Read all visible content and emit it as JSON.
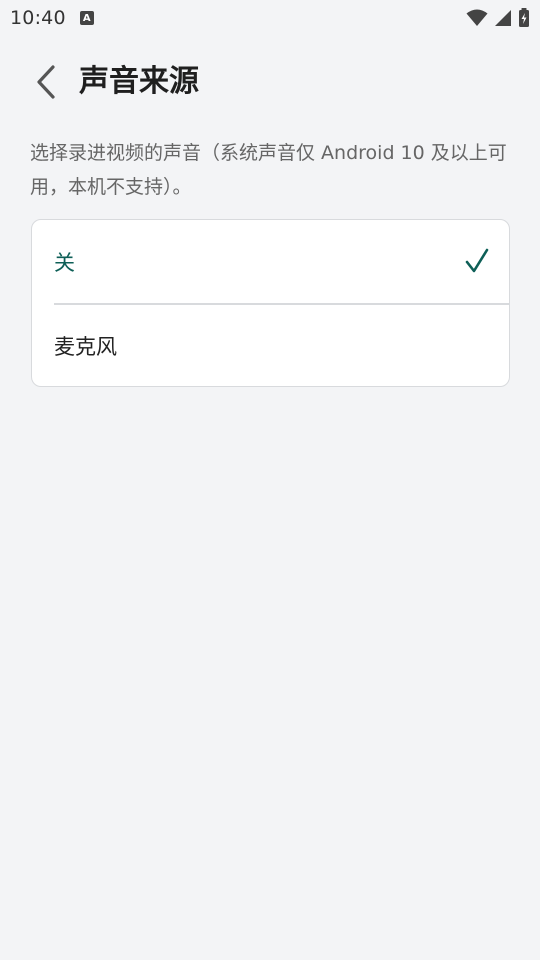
{
  "status_bar": {
    "time": "10:40",
    "notification_icon": "a-icon",
    "icons": [
      "wifi-icon",
      "cellular-signal-icon",
      "battery-charging-icon"
    ]
  },
  "header": {
    "back_icon": "chevron-left-icon",
    "title": "声音来源"
  },
  "description": "选择录进视频的声音（系统声音仅 Android 10 及以上可用，本机不支持）。",
  "options": [
    {
      "label": "关",
      "selected": true
    },
    {
      "label": "麦克风",
      "selected": false
    }
  ],
  "colors": {
    "accent": "#0e5f57",
    "background": "#f3f4f6",
    "card": "#ffffff",
    "border": "#d8dadd"
  }
}
